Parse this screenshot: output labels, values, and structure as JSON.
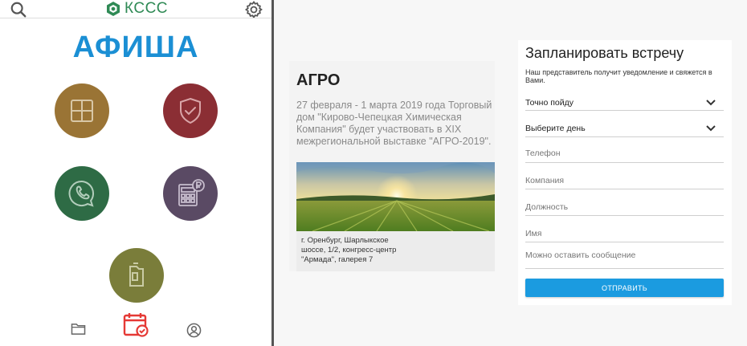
{
  "header": {
    "logo_text": "КССС",
    "icons": {
      "search": "search-icon",
      "settings": "gear-icon",
      "logo": "logo-hexagon-icon"
    }
  },
  "left": {
    "title": "АФИША",
    "tiles": [
      {
        "name": "grid",
        "color": "#9a7435",
        "icon": "grid-icon"
      },
      {
        "name": "shield",
        "color": "#8b2e34",
        "icon": "shield-check-icon"
      },
      {
        "name": "phone",
        "color": "#2e6b45",
        "icon": "phone-chat-icon"
      },
      {
        "name": "calculator",
        "color": "#5a4a64",
        "icon": "calculator-ruble-icon"
      },
      {
        "name": "canister",
        "color": "#7a7d3a",
        "icon": "canister-icon"
      }
    ],
    "bottom_nav": [
      "folder-icon",
      "calendar-check-icon",
      "user-circle-icon"
    ],
    "active_nav_color": "#e53935"
  },
  "event": {
    "title": "АГРО",
    "description": "27 февраля - 1 марта 2019 года Торговый дом \"Кирово-Чепецкая Химическая Компания\" будет участвовать в XIX межрегиональной выставке \"АГРО-2019\".",
    "address_lines": [
      "г. Оренбург, Шарлыкское",
      "шоссе, 1/2, конгресс-центр",
      "\"Армада\", галерея 7"
    ]
  },
  "form": {
    "title": "Запланировать встречу",
    "subtitle": "Наш представитель получит уведомление и свяжется в Вами.",
    "select_attendance": "Точно пойду",
    "select_day": "Выберите день",
    "phone_placeholder": "Телефон",
    "company_placeholder": "Компания",
    "position_placeholder": "Должность",
    "name_placeholder": "Имя",
    "message_placeholder": "Можно оставить сообщение",
    "submit_label": "ОТПРАВИТЬ",
    "accent": "#1b9be0"
  }
}
